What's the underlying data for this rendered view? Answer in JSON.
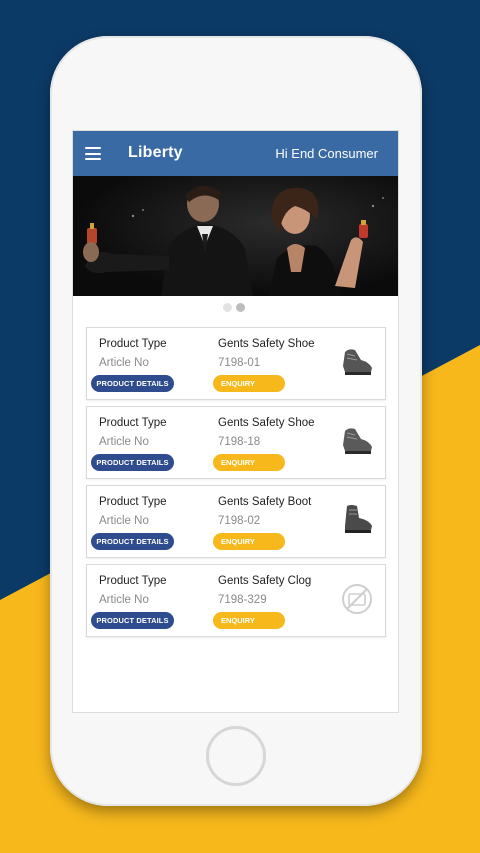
{
  "app": {
    "title": "Liberty",
    "greeting": "Hi End Consumer"
  },
  "colors": {
    "appbar": "#3a6aa3",
    "details_button": "#2f4c8f",
    "enquiry_button": "#f7b81c",
    "background_navy": "#0c3a66",
    "background_yellow": "#f7b81c"
  },
  "banner": {
    "page_count": 2,
    "active_page": 2
  },
  "products": [
    {
      "type_label": "Product Type",
      "type_value": "Gents Safety Shoe",
      "article_label": "Article No",
      "article_value": "7198-01",
      "details_label": "PRODUCT DETAILS",
      "enquiry_label": "ENQUIRY",
      "thumbnail": "shoe-image"
    },
    {
      "type_label": "Product Type",
      "type_value": "Gents Safety Shoe",
      "article_label": "Article No",
      "article_value": "7198-18",
      "details_label": "PRODUCT DETAILS",
      "enquiry_label": "ENQUIRY",
      "thumbnail": "shoe-image"
    },
    {
      "type_label": "Product Type",
      "type_value": "Gents Safety Boot",
      "article_label": "Article No",
      "article_value": "7198-02",
      "details_label": "PRODUCT DETAILS",
      "enquiry_label": "ENQUIRY",
      "thumbnail": "boot-image"
    },
    {
      "type_label": "Product Type",
      "type_value": "Gents Safety Clog",
      "article_label": "Article No",
      "article_value": "7198-329",
      "details_label": "PRODUCT DETAILS",
      "enquiry_label": "ENQUIRY",
      "thumbnail": "no-image-icon"
    }
  ]
}
